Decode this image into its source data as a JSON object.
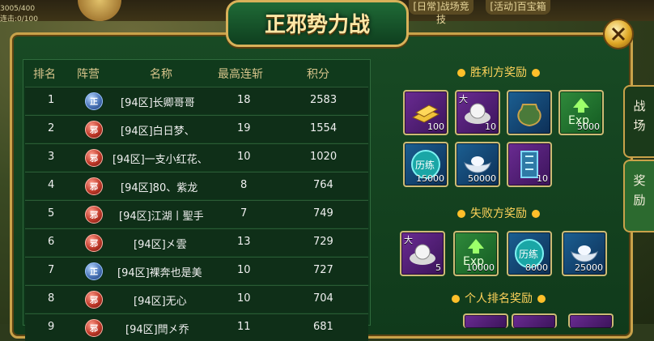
{
  "hud": {
    "hp_text": "3005/400",
    "mp_text": "连击:0/100"
  },
  "top_tabs": [
    "[日常]战场竞技",
    "[活动]百宝箱"
  ],
  "dialog": {
    "title": "正邪势力战",
    "close": "关闭"
  },
  "table": {
    "headers": [
      "排名",
      "阵营",
      "名称",
      "最高连斩",
      "积分"
    ],
    "rows": [
      {
        "rank": "1",
        "camp": "正",
        "camp_type": "zheng",
        "name": "[94区]长卿哥哥",
        "streak": "18",
        "score": "2583"
      },
      {
        "rank": "2",
        "camp": "邪",
        "camp_type": "xie",
        "name": "[94区]白日梦、",
        "streak": "19",
        "score": "1554"
      },
      {
        "rank": "3",
        "camp": "邪",
        "camp_type": "xie",
        "name": "[94区]一支小红花、",
        "streak": "10",
        "score": "1020"
      },
      {
        "rank": "4",
        "camp": "邪",
        "camp_type": "xie",
        "name": "[94区]80、紫龙",
        "streak": "8",
        "score": "764"
      },
      {
        "rank": "5",
        "camp": "邪",
        "camp_type": "xie",
        "name": "[94区]江湖丨聖手",
        "streak": "7",
        "score": "749"
      },
      {
        "rank": "6",
        "camp": "邪",
        "camp_type": "xie",
        "name": "[94区]㐅雲",
        "streak": "13",
        "score": "729"
      },
      {
        "rank": "7",
        "camp": "正",
        "camp_type": "zheng",
        "name": "[94区]裸奔也是美",
        "streak": "10",
        "score": "727"
      },
      {
        "rank": "8",
        "camp": "邪",
        "camp_type": "xie",
        "name": "[94区]无心",
        "streak": "10",
        "score": "704"
      },
      {
        "rank": "9",
        "camp": "邪",
        "camp_type": "xie",
        "name": "[94区]閆㐅乔",
        "streak": "11",
        "score": "681"
      }
    ]
  },
  "rewards": {
    "win_title": "胜利方奖励",
    "lose_title": "失败方奖励",
    "personal_title": "个人排名奖励",
    "win_items": [
      {
        "icon": "gold-bar-icon",
        "qty": "100",
        "rarity": "purple",
        "corner": ""
      },
      {
        "icon": "pearl-icon",
        "qty": "10",
        "rarity": "purple",
        "corner": "大"
      },
      {
        "icon": "jar-icon",
        "qty": "",
        "rarity": "blue",
        "corner": ""
      },
      {
        "icon": "exp-icon",
        "qty": "5000",
        "rarity": "green",
        "corner": ""
      },
      {
        "icon": "experience-orb-icon",
        "qty": "15000",
        "rarity": "blue",
        "corner": "",
        "label": "历练"
      },
      {
        "icon": "silver-ingot-icon",
        "qty": "50000",
        "rarity": "blue",
        "corner": ""
      },
      {
        "icon": "rune-scroll-icon",
        "qty": "10",
        "rarity": "purple",
        "corner": ""
      }
    ],
    "lose_items": [
      {
        "icon": "pearl-icon",
        "qty": "5",
        "rarity": "purple",
        "corner": "大"
      },
      {
        "icon": "exp-icon",
        "qty": "10000",
        "rarity": "green",
        "corner": ""
      },
      {
        "icon": "experience-orb-icon",
        "qty": "8000",
        "rarity": "blue",
        "corner": "",
        "label": "历练"
      },
      {
        "icon": "silver-ingot-icon",
        "qty": "25000",
        "rarity": "blue",
        "corner": ""
      }
    ]
  },
  "side_tabs": [
    "战场",
    "奖励"
  ],
  "colors": {
    "gold": "#ffd35a",
    "panel": "#184a24",
    "text": "#f0f0f0",
    "header": "#d7c48b"
  }
}
